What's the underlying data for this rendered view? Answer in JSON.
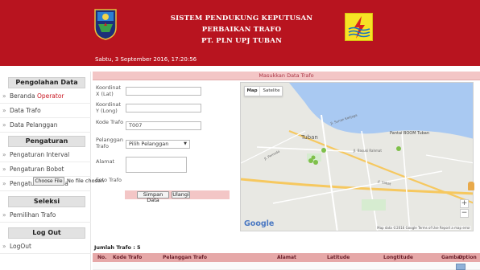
{
  "header": {
    "title_lines": [
      "SISTEM PENDUKUNG KEPUTUSAN",
      "PERBAIKAN TRAFO",
      "PT. PLN UPJ TUBAN"
    ],
    "datetime": "Sabtu, 3 September 2016,  17:20:56",
    "left_logo": "regional-emblem",
    "right_logo": "pln-lightning-logo",
    "colors": {
      "banner": "#b8141f",
      "pln_yellow": "#f7e225"
    }
  },
  "sidebar": {
    "sections": [
      {
        "title": "Pengolahan Data",
        "items": [
          {
            "label": "Beranda",
            "accent": "Operator"
          },
          {
            "label": "Data Trafo"
          },
          {
            "label": "Data Pelanggan"
          }
        ]
      },
      {
        "title": "Pengaturan",
        "items": [
          {
            "label": "Pengaturan Interval"
          },
          {
            "label": "Pengaturan Bobot"
          },
          {
            "label": "Pengaturan Kriteria"
          }
        ]
      },
      {
        "title": "Seleksi",
        "items": [
          {
            "label": "Pemilihan Trafo"
          }
        ]
      },
      {
        "title": "Log Out",
        "items": [
          {
            "label": "LogOut"
          }
        ]
      }
    ],
    "arrow": "»"
  },
  "form": {
    "title": "Masukkan Data Trafo",
    "fields": {
      "lat": {
        "label": "Koordinat X (Lat)",
        "value": ""
      },
      "long": {
        "label": "Koordinat Y (Long)",
        "value": ""
      },
      "kode": {
        "label": "Kode Trafo",
        "value": "T007"
      },
      "pelanggan": {
        "label": "Pelanggan Trafo",
        "value": "Pilih Pelanggan"
      },
      "alamat": {
        "label": "Alamat",
        "value": ""
      },
      "foto": {
        "label": "Foto Trafo",
        "button": "Choose File",
        "status": "No file chosen"
      }
    },
    "buttons": {
      "save": "Simpan Data",
      "reset": "Ulangi"
    }
  },
  "map": {
    "tabs": {
      "map": "Map",
      "satellite": "Satelite"
    },
    "place_labels": [
      "Tuban",
      "Pantai BOOM Tuban",
      "Jl. Sunan Kalijaga",
      "Jl. Basuki Rahmat",
      "Jl. Sabat",
      "Jl. Pemuda"
    ],
    "provider": "Google",
    "credit": "Map data ©2016 Google   Terms of Use   Report a map error",
    "zoom_in": "+",
    "zoom_out": "−",
    "colors": {
      "sea": "#a9c9f2",
      "land": "#e8e8e3",
      "road": "#f6c85f",
      "marker": "#7fc04a"
    }
  },
  "table": {
    "count_text": "Jumlah Trafo : 5",
    "columns": [
      "No.",
      "Kode Trafo",
      "Pelanggan Trafo",
      "Alamat",
      "Latitude",
      "Longtitude",
      "Gambar",
      "Option"
    ]
  }
}
